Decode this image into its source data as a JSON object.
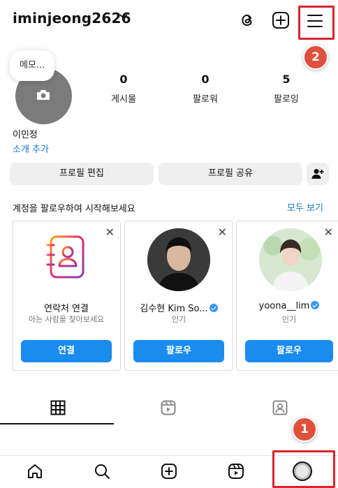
{
  "header": {
    "username": "iminjeong2626",
    "icons": [
      "threads-icon",
      "plus-square-icon",
      "hamburger-menu-icon"
    ]
  },
  "profile": {
    "memo": "메모...",
    "display_name": "이민정",
    "add_bio": "소개 추가",
    "stats": [
      {
        "value": "0",
        "label": "게시물"
      },
      {
        "value": "0",
        "label": "팔로워"
      },
      {
        "value": "5",
        "label": "팔로잉"
      }
    ]
  },
  "buttons": {
    "edit_profile": "프로필 편집",
    "share_profile": "프로필 공유"
  },
  "suggestions": {
    "title": "계정을 팔로우하여 시작해보세요",
    "see_all": "모두 보기",
    "cards": [
      {
        "name": "연락처 연결",
        "sub": "아는 사람을 찾아보세요",
        "button": "연결"
      },
      {
        "name": "김수현 Kim So...",
        "sub": "인기",
        "button": "팔로우"
      },
      {
        "name": "yoona__lim",
        "sub": "인기",
        "button": "팔로우"
      }
    ]
  },
  "annotations": {
    "badge_1": "1",
    "badge_2": "2"
  },
  "colors": {
    "accent": "#1a8cf0",
    "link": "#1877c9",
    "highlight": "#d9242c",
    "badge": "#e1503c"
  }
}
